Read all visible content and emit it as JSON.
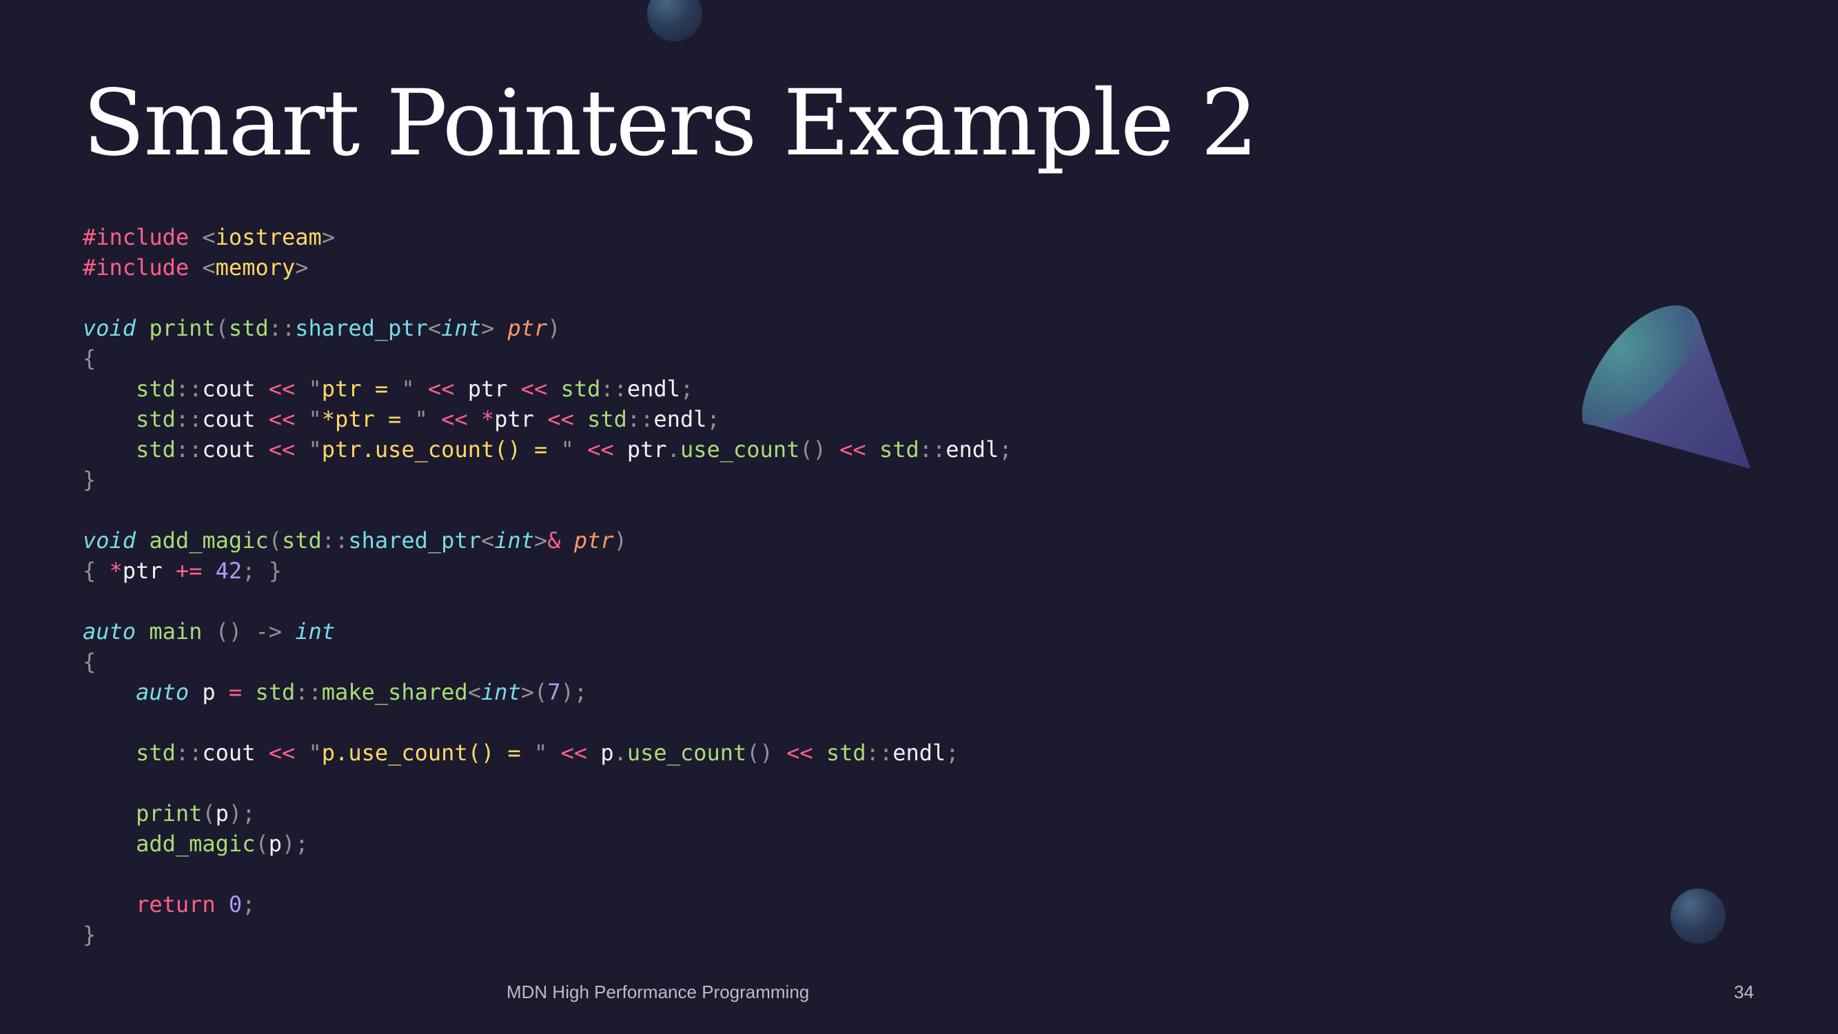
{
  "slide": {
    "title": "Smart Pointers Example 2",
    "footer": "MDN High Performance Programming",
    "page_number": "34"
  },
  "code": {
    "lines": [
      [
        {
          "t": "#include ",
          "c": "kw"
        },
        {
          "t": "<",
          "c": "pu"
        },
        {
          "t": "iostream",
          "c": "st"
        },
        {
          "t": ">",
          "c": "pu"
        }
      ],
      [
        {
          "t": "#include ",
          "c": "kw"
        },
        {
          "t": "<",
          "c": "pu"
        },
        {
          "t": "memory",
          "c": "st"
        },
        {
          "t": ">",
          "c": "pu"
        }
      ],
      [],
      [
        {
          "t": "void",
          "c": "ty"
        },
        {
          "t": " ",
          "c": "id"
        },
        {
          "t": "print",
          "c": "fn"
        },
        {
          "t": "(",
          "c": "pu"
        },
        {
          "t": "std",
          "c": "ns"
        },
        {
          "t": "::",
          "c": "pu"
        },
        {
          "t": "shared_ptr",
          "c": "ty-plain"
        },
        {
          "t": "<",
          "c": "pu"
        },
        {
          "t": "int",
          "c": "ty"
        },
        {
          "t": "> ",
          "c": "pu"
        },
        {
          "t": "ptr",
          "c": "pm"
        },
        {
          "t": ")",
          "c": "pu"
        }
      ],
      [
        {
          "t": "{",
          "c": "pu"
        }
      ],
      [
        {
          "t": "    ",
          "c": "id"
        },
        {
          "t": "std",
          "c": "ns"
        },
        {
          "t": "::",
          "c": "pu"
        },
        {
          "t": "cout ",
          "c": "id"
        },
        {
          "t": "<< ",
          "c": "op"
        },
        {
          "t": "\"",
          "c": "pu"
        },
        {
          "t": "ptr = ",
          "c": "st"
        },
        {
          "t": "\" ",
          "c": "pu"
        },
        {
          "t": "<< ",
          "c": "op"
        },
        {
          "t": "ptr ",
          "c": "id"
        },
        {
          "t": "<< ",
          "c": "op"
        },
        {
          "t": "std",
          "c": "ns"
        },
        {
          "t": "::",
          "c": "pu"
        },
        {
          "t": "endl",
          "c": "id"
        },
        {
          "t": ";",
          "c": "pu"
        }
      ],
      [
        {
          "t": "    ",
          "c": "id"
        },
        {
          "t": "std",
          "c": "ns"
        },
        {
          "t": "::",
          "c": "pu"
        },
        {
          "t": "cout ",
          "c": "id"
        },
        {
          "t": "<< ",
          "c": "op"
        },
        {
          "t": "\"",
          "c": "pu"
        },
        {
          "t": "*ptr = ",
          "c": "st"
        },
        {
          "t": "\" ",
          "c": "pu"
        },
        {
          "t": "<< ",
          "c": "op"
        },
        {
          "t": "*",
          "c": "op"
        },
        {
          "t": "ptr ",
          "c": "id"
        },
        {
          "t": "<< ",
          "c": "op"
        },
        {
          "t": "std",
          "c": "ns"
        },
        {
          "t": "::",
          "c": "pu"
        },
        {
          "t": "endl",
          "c": "id"
        },
        {
          "t": ";",
          "c": "pu"
        }
      ],
      [
        {
          "t": "    ",
          "c": "id"
        },
        {
          "t": "std",
          "c": "ns"
        },
        {
          "t": "::",
          "c": "pu"
        },
        {
          "t": "cout ",
          "c": "id"
        },
        {
          "t": "<< ",
          "c": "op"
        },
        {
          "t": "\"",
          "c": "pu"
        },
        {
          "t": "ptr.use_count() = ",
          "c": "st"
        },
        {
          "t": "\" ",
          "c": "pu"
        },
        {
          "t": "<< ",
          "c": "op"
        },
        {
          "t": "ptr",
          "c": "id"
        },
        {
          "t": ".",
          "c": "pu"
        },
        {
          "t": "use_count",
          "c": "fn"
        },
        {
          "t": "() ",
          "c": "pu"
        },
        {
          "t": "<< ",
          "c": "op"
        },
        {
          "t": "std",
          "c": "ns"
        },
        {
          "t": "::",
          "c": "pu"
        },
        {
          "t": "endl",
          "c": "id"
        },
        {
          "t": ";",
          "c": "pu"
        }
      ],
      [
        {
          "t": "}",
          "c": "pu"
        }
      ],
      [],
      [
        {
          "t": "void",
          "c": "ty"
        },
        {
          "t": " ",
          "c": "id"
        },
        {
          "t": "add_magic",
          "c": "fn"
        },
        {
          "t": "(",
          "c": "pu"
        },
        {
          "t": "std",
          "c": "ns"
        },
        {
          "t": "::",
          "c": "pu"
        },
        {
          "t": "shared_ptr",
          "c": "ty-plain"
        },
        {
          "t": "<",
          "c": "pu"
        },
        {
          "t": "int",
          "c": "ty"
        },
        {
          "t": ">",
          "c": "pu"
        },
        {
          "t": "& ",
          "c": "op"
        },
        {
          "t": "ptr",
          "c": "pm"
        },
        {
          "t": ")",
          "c": "pu"
        }
      ],
      [
        {
          "t": "{ ",
          "c": "pu"
        },
        {
          "t": "*",
          "c": "op"
        },
        {
          "t": "ptr ",
          "c": "id"
        },
        {
          "t": "+= ",
          "c": "op"
        },
        {
          "t": "42",
          "c": "nu"
        },
        {
          "t": "; }",
          "c": "pu"
        }
      ],
      [],
      [
        {
          "t": "auto",
          "c": "ty"
        },
        {
          "t": " ",
          "c": "id"
        },
        {
          "t": "main ",
          "c": "fn"
        },
        {
          "t": "() -> ",
          "c": "pu"
        },
        {
          "t": "int",
          "c": "ty"
        }
      ],
      [
        {
          "t": "{",
          "c": "pu"
        }
      ],
      [
        {
          "t": "    ",
          "c": "id"
        },
        {
          "t": "auto",
          "c": "ty"
        },
        {
          "t": " p ",
          "c": "id"
        },
        {
          "t": "= ",
          "c": "op"
        },
        {
          "t": "std",
          "c": "ns"
        },
        {
          "t": "::",
          "c": "pu"
        },
        {
          "t": "make_shared",
          "c": "fn"
        },
        {
          "t": "<",
          "c": "pu"
        },
        {
          "t": "int",
          "c": "ty"
        },
        {
          "t": ">(",
          "c": "pu"
        },
        {
          "t": "7",
          "c": "nu"
        },
        {
          "t": ");",
          "c": "pu"
        }
      ],
      [],
      [
        {
          "t": "    ",
          "c": "id"
        },
        {
          "t": "std",
          "c": "ns"
        },
        {
          "t": "::",
          "c": "pu"
        },
        {
          "t": "cout ",
          "c": "id"
        },
        {
          "t": "<< ",
          "c": "op"
        },
        {
          "t": "\"",
          "c": "pu"
        },
        {
          "t": "p.use_count() = ",
          "c": "st"
        },
        {
          "t": "\" ",
          "c": "pu"
        },
        {
          "t": "<< ",
          "c": "op"
        },
        {
          "t": "p",
          "c": "id"
        },
        {
          "t": ".",
          "c": "pu"
        },
        {
          "t": "use_count",
          "c": "fn"
        },
        {
          "t": "() ",
          "c": "pu"
        },
        {
          "t": "<< ",
          "c": "op"
        },
        {
          "t": "std",
          "c": "ns"
        },
        {
          "t": "::",
          "c": "pu"
        },
        {
          "t": "endl",
          "c": "id"
        },
        {
          "t": ";",
          "c": "pu"
        }
      ],
      [],
      [
        {
          "t": "    ",
          "c": "id"
        },
        {
          "t": "print",
          "c": "fn"
        },
        {
          "t": "(",
          "c": "pu"
        },
        {
          "t": "p",
          "c": "id"
        },
        {
          "t": ");",
          "c": "pu"
        }
      ],
      [
        {
          "t": "    ",
          "c": "id"
        },
        {
          "t": "add_magic",
          "c": "fn"
        },
        {
          "t": "(",
          "c": "pu"
        },
        {
          "t": "p",
          "c": "id"
        },
        {
          "t": ");",
          "c": "pu"
        }
      ],
      [],
      [
        {
          "t": "    ",
          "c": "id"
        },
        {
          "t": "return",
          "c": "kw"
        },
        {
          "t": " ",
          "c": "id"
        },
        {
          "t": "0",
          "c": "nu"
        },
        {
          "t": ";",
          "c": "pu"
        }
      ],
      [
        {
          "t": "}",
          "c": "pu"
        }
      ]
    ]
  },
  "colors": {
    "background": "#1c1a2e",
    "title": "#ffffff",
    "keyword": "#ff6188",
    "type": "#78dce8",
    "function": "#a9dc76",
    "string": "#ffd866",
    "number": "#ab9df2",
    "parameter": "#fc9867",
    "punctuation": "#939293",
    "footer": "#bdbdc7"
  },
  "decorations": {
    "shapes": [
      "sphere",
      "cone",
      "sphere"
    ]
  }
}
